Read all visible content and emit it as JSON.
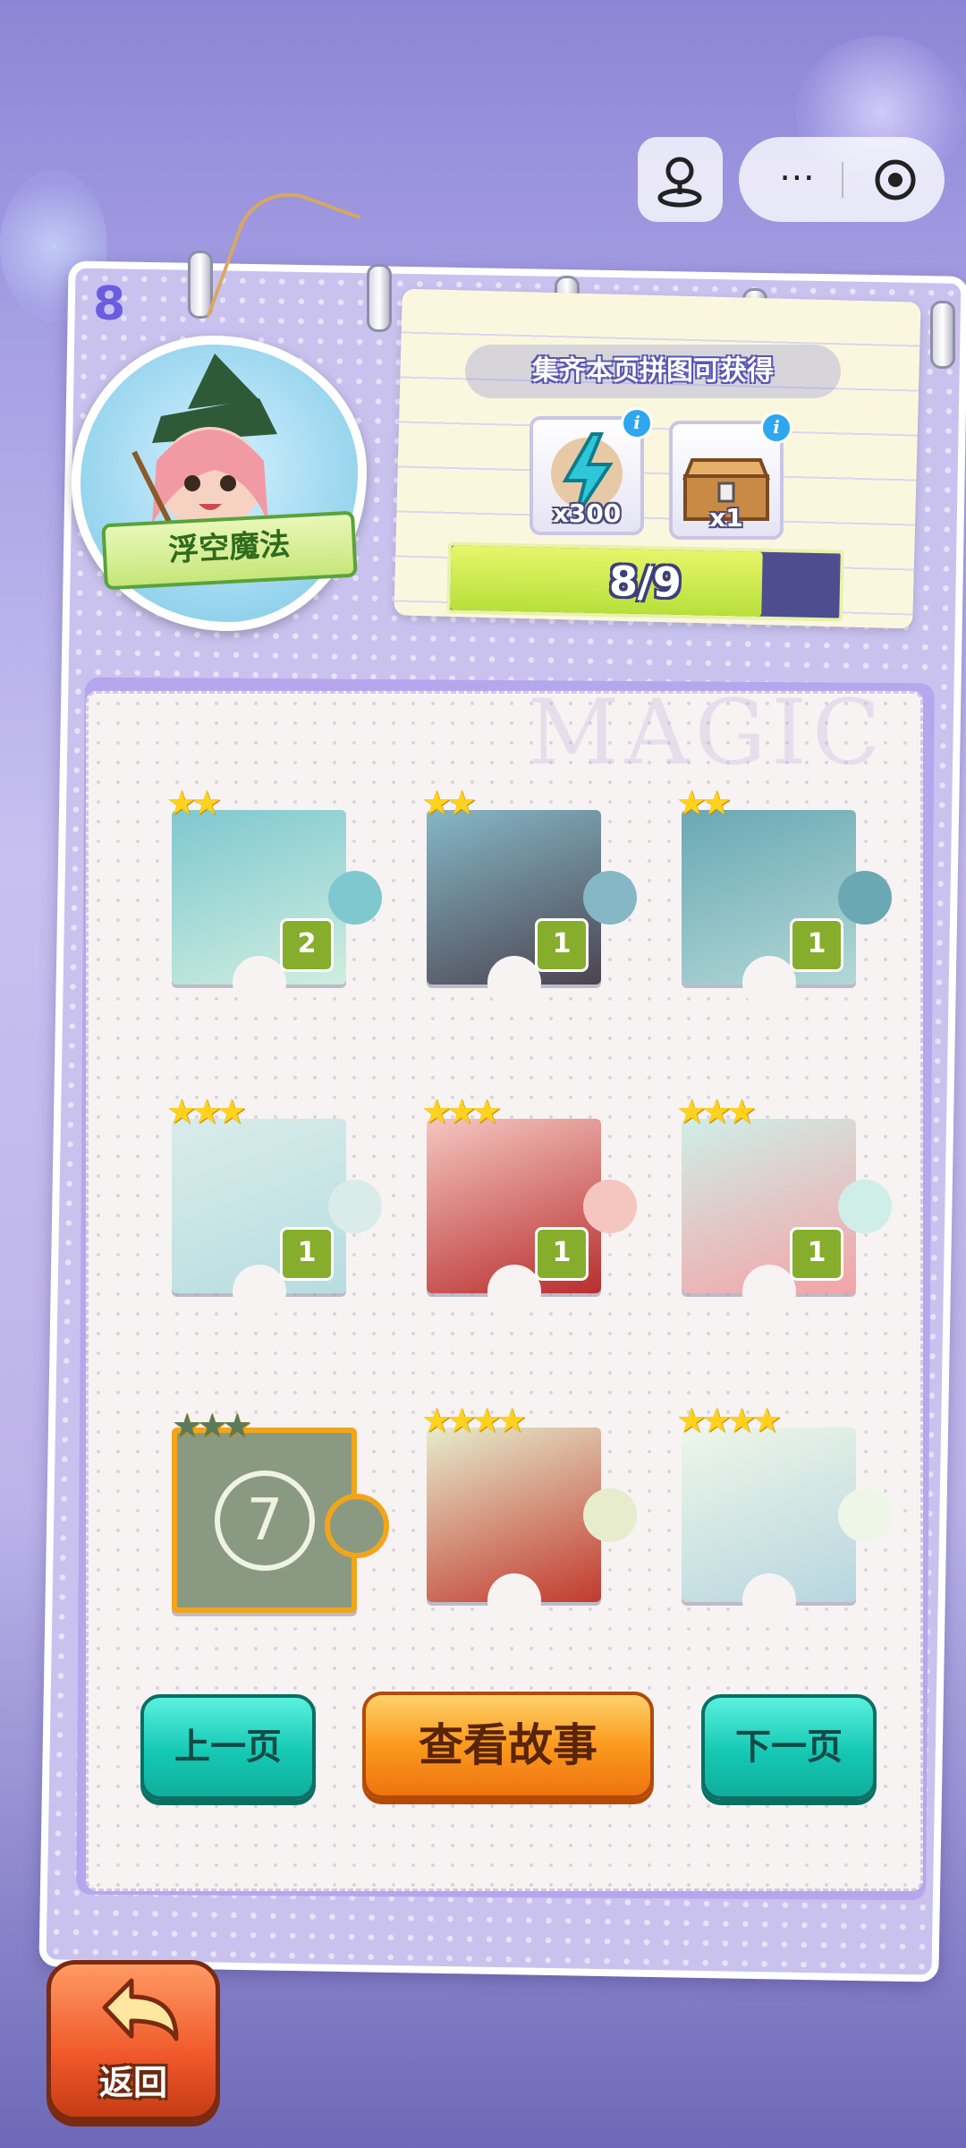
{
  "header": {
    "page_number": "8",
    "menu_more_icon": "more-dots-icon",
    "close_icon": "target-icon",
    "profile_icon": "joystick-icon"
  },
  "badge": {
    "name": "浮空魔法"
  },
  "reward": {
    "title": "集齐本页拼图可获得",
    "items": [
      {
        "icon": "lightning-icon",
        "count": "x300"
      },
      {
        "icon": "chest-icon",
        "count": "x1"
      }
    ],
    "info_label": "i",
    "progress_text": "8/9",
    "progress_fraction": 0.8
  },
  "board": {
    "watermark": "MAGIC",
    "pieces": [
      {
        "stars": "★★",
        "count": "2",
        "locked": false,
        "art": "sky-stars"
      },
      {
        "stars": "★★",
        "count": "1",
        "locked": false,
        "art": "witch-hat"
      },
      {
        "stars": "★★",
        "count": "1",
        "locked": false,
        "art": "potion"
      },
      {
        "stars": "★★★",
        "count": "1",
        "locked": false,
        "art": "wand-book"
      },
      {
        "stars": "★★★",
        "count": "1",
        "locked": false,
        "art": "witch-face"
      },
      {
        "stars": "★★★",
        "count": "1",
        "locked": false,
        "art": "red-book"
      },
      {
        "stars": "★★★",
        "count": "",
        "locked": true,
        "lock_number": "7"
      },
      {
        "stars": "★★★★",
        "count": "",
        "locked": false,
        "art": "shoes"
      },
      {
        "stars": "★★★★",
        "count": "",
        "locked": false,
        "art": "open-book"
      }
    ]
  },
  "buttons": {
    "prev": "上一页",
    "story": "查看故事",
    "next": "下一页",
    "back": "返回"
  },
  "colors": {
    "teal_button": "#15c9b4",
    "orange_button": "#fb9a1e",
    "progress_fill": "#c6e84a",
    "star": "#ffd21e"
  }
}
